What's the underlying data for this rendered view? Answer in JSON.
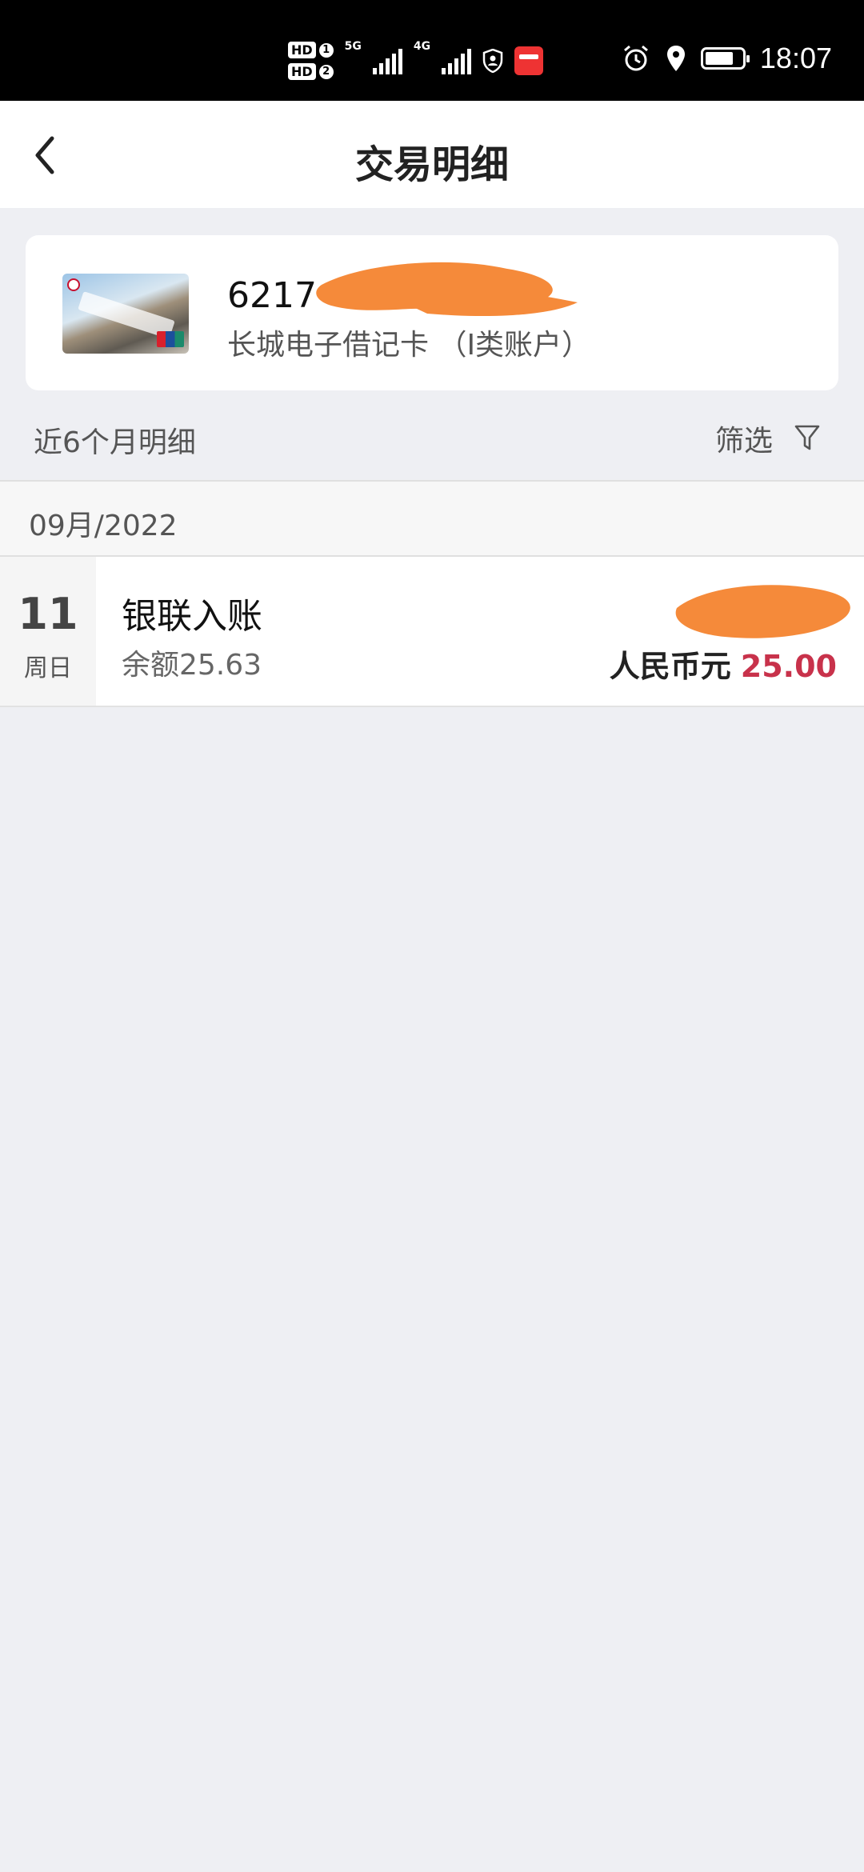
{
  "status_bar": {
    "time": "18:07",
    "sim1_label": "HD",
    "sim1_num": "1",
    "sim2_label": "HD",
    "sim2_num": "2",
    "network1": "5G",
    "network2": "4G",
    "battery_level": 0.8
  },
  "header": {
    "title": "交易明细",
    "back_icon": "chevron-left-icon"
  },
  "card": {
    "number_prefix": "6217",
    "type_label": "长城电子借记卡 （I类账户）"
  },
  "filter": {
    "range_label": "近6个月明细",
    "filter_label": "筛选",
    "filter_icon": "funnel-icon"
  },
  "month": {
    "label": "09月/2022"
  },
  "transactions": [
    {
      "day": "11",
      "weekday": "周日",
      "title": "银联入账",
      "balance": "余额25.63",
      "currency": "人民币元",
      "amount": "25.00"
    }
  ],
  "colors": {
    "amount": "#c8324b",
    "redaction": "#f58a3a",
    "background": "#eeeff3"
  }
}
